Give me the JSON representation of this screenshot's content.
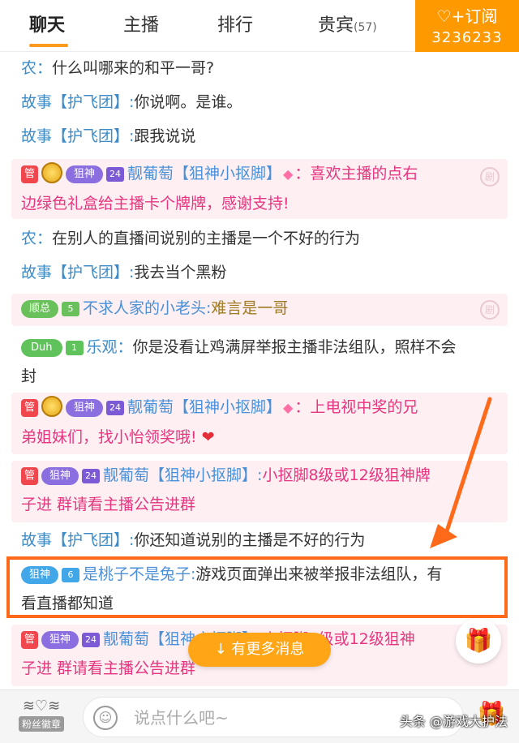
{
  "tabs": [
    {
      "label": "聊天"
    },
    {
      "label": "主播"
    },
    {
      "label": "排行"
    },
    {
      "label": "贵宾",
      "count": "(57)"
    }
  ],
  "subscribe": {
    "label": "订阅",
    "count": "3236233"
  },
  "messages": [
    {
      "nick": "农：",
      "text": "什么叫哪来的和平一哥?"
    },
    {
      "nick": "故事【护飞团】:",
      "text": "你说啊。是谁。"
    },
    {
      "nick": "故事【护飞团】:",
      "text": "跟我说说"
    },
    {
      "badge1": "管",
      "badge2": "狙神",
      "level": "24",
      "nick": "靓葡萄【狙神小抠脚】",
      "text": "：喜欢主播的点右",
      "text2": "边绿色礼盒给主播卡个牌牌，感谢支持!",
      "side": "剧"
    },
    {
      "nick": "农：",
      "text": "在别人的直播间说别的主播是一个不好的行为"
    },
    {
      "nick": "故事【护飞团】:",
      "text": "我去当个黑粉"
    },
    {
      "badge": "顺总",
      "level": "5",
      "nick": "不求人家的小老头:",
      "text": "难言是一哥",
      "side": "剧"
    },
    {
      "badge": "Duh",
      "level": "1",
      "nick": "乐观：",
      "text": "你是没看让鸡满屏举报主播非法组队，照样不会",
      "text2": "封"
    },
    {
      "badge1": "管",
      "badge2": "狙神",
      "level": "24",
      "nick": "靓葡萄【狙神小抠脚】",
      "text": "：上电视中奖的兄",
      "text2": "弟姐妹们，找小怡领奖哦!"
    },
    {
      "badge1": "管",
      "badge2": "狙神",
      "level": "24",
      "nick": "靓葡萄【狙神小抠脚】:",
      "text": "小抠脚8级或12级狙神牌",
      "text2": "子进 群请看主播公告进群"
    },
    {
      "nick": "故事【护飞团】:",
      "text": "你还知道说别的主播是不好的行为"
    },
    {
      "badge": "狙神",
      "level": "6",
      "nick": "是桃子不是兔子:",
      "text": "游戏页面弹出来被举报非法组队，有",
      "text2": "看直播都知道"
    },
    {
      "badge1": "管",
      "badge2": "狙神",
      "level": "24",
      "nick": "靓葡萄【狙神小抠脚】:",
      "text": "小抠脚8级或12级狙神",
      "text2": "子进 群请看主播公告进群"
    }
  ],
  "more_messages": "有更多消息",
  "bottom": {
    "fan_badge": "粉丝徽章",
    "placeholder": "说点什么吧~"
  },
  "watermark": "头条 @游戏大护法",
  "colors": {
    "accent": "#ff9900",
    "highlight_box": "#ff6a1a",
    "nick": "#3d8cc9",
    "pink_text": "#e8357f"
  }
}
